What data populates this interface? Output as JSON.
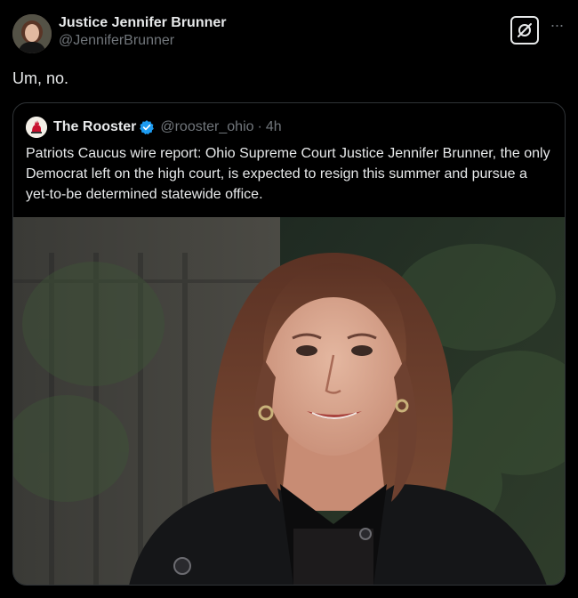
{
  "author": {
    "display_name": "Justice Jennifer Brunner",
    "handle": "@JenniferBrunner",
    "avatar": "profile-photo"
  },
  "actions": {
    "grok_icon": "grok-icon",
    "more_label": "···"
  },
  "tweet": {
    "text": "Um, no."
  },
  "quote": {
    "display_name": "The Rooster",
    "verified_icon": "verified-badge-icon",
    "handle": "@rooster_ohio",
    "separator": "·",
    "time": "4h",
    "text": "Patriots Caucus wire report: Ohio Supreme Court Justice Jennifer Brunner, the only Democrat left on the high court, is expected to resign this summer and pursue a yet-to-be determined statewide office.",
    "media": "portrait-photo"
  },
  "colors": {
    "background": "#000000",
    "text_primary": "#e7e9ea",
    "text_secondary": "#71767b",
    "border": "#2f3336",
    "verified_blue": "#1d9bf0"
  }
}
